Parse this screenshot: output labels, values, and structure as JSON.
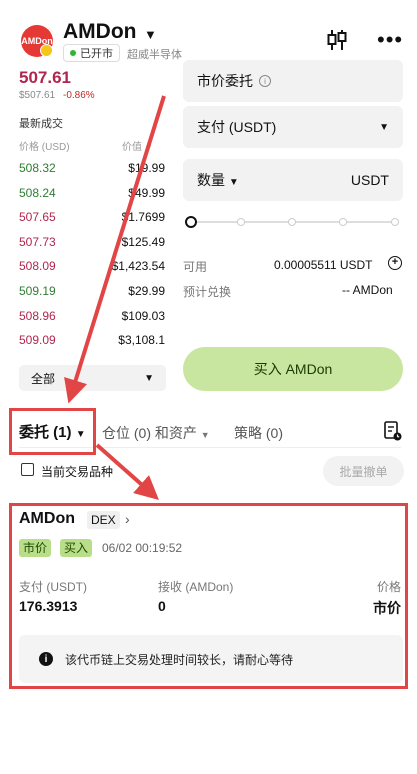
{
  "header": {
    "logo_text": "AMDon",
    "title": "AMDon",
    "status": "已开市",
    "sector": "超威半导体"
  },
  "quote": {
    "price": "507.61",
    "sub_price": "$507.61",
    "change": "-0.86%"
  },
  "trades": {
    "title": "最新成交",
    "col_price": "价格 (USD)",
    "col_value": "价值",
    "rows": [
      {
        "price": "508.32",
        "value": "$19.99",
        "color": "green"
      },
      {
        "price": "508.24",
        "value": "$49.99",
        "color": "green"
      },
      {
        "price": "507.65",
        "value": "$1.7699",
        "color": "red"
      },
      {
        "price": "507.73",
        "value": "$125.49",
        "color": "red"
      },
      {
        "price": "508.09",
        "value": "$1,423.54",
        "color": "red"
      },
      {
        "price": "509.19",
        "value": "$29.99",
        "color": "green"
      },
      {
        "price": "508.96",
        "value": "$109.03",
        "color": "red"
      },
      {
        "price": "509.09",
        "value": "$3,108.1",
        "color": "red"
      }
    ],
    "filter": "全部"
  },
  "form": {
    "order_type": "市价委托",
    "pay": "支付 (USDT)",
    "qty_label": "数量",
    "qty_unit": "USDT",
    "slider_percent": 0,
    "avail_label": "可用",
    "avail_value": "0.00005511 USDT",
    "est_label": "预计兑换",
    "est_value": "-- AMDon",
    "buy_button": "买入 AMDon"
  },
  "tabs": {
    "orders": "委托 (1)",
    "positions": "仓位 (0) 和资产",
    "strategy": "策略 (0)"
  },
  "filters": {
    "current_pair": "当前交易品种",
    "batch_cancel": "批量撤单"
  },
  "order": {
    "name": "AMDon",
    "venue": "DEX",
    "type_tag": "市价",
    "side_tag": "买入",
    "time": "06/02 00:19:52",
    "pay_label": "支付 (USDT)",
    "pay_value": "176.3913",
    "recv_label": "接收 (AMDon)",
    "recv_value": "0",
    "price_label": "价格",
    "price_value": "市价",
    "notice": "该代币链上交易处理时间较长，请耐心等待"
  },
  "colors": {
    "annotation": "#e24545",
    "buy_button": "#c8e6a0",
    "up": "#2e7d32",
    "down": "#b0264e"
  }
}
